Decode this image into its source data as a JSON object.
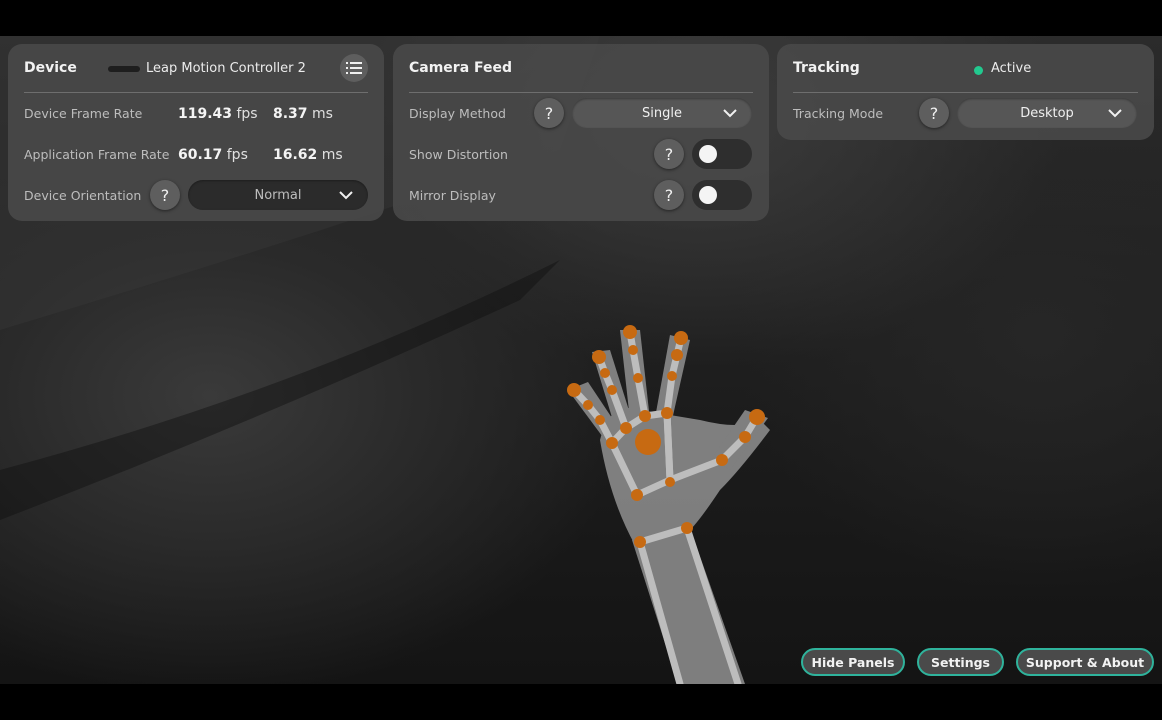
{
  "device": {
    "title": "Device",
    "device_name": "Leap Motion Controller 2",
    "menu_icon": "list-icon",
    "device_frame_rate": {
      "label": "Device Frame Rate",
      "fps": "119.43",
      "fps_unit": "fps",
      "ms": "8.37",
      "ms_unit": "ms"
    },
    "app_frame_rate": {
      "label": "Application Frame Rate",
      "fps": "60.17",
      "fps_unit": "fps",
      "ms": "16.62",
      "ms_unit": "ms"
    },
    "orientation": {
      "label": "Device Orientation",
      "help": "?",
      "value": "Normal"
    }
  },
  "camera_feed": {
    "title": "Camera Feed",
    "display_method": {
      "label": "Display Method",
      "help": "?",
      "value": "Single"
    },
    "show_distortion": {
      "label": "Show Distortion",
      "help": "?",
      "enabled": false
    },
    "mirror_display": {
      "label": "Mirror Display",
      "help": "?",
      "enabled": false
    }
  },
  "tracking": {
    "title": "Tracking",
    "status": "Active",
    "status_color": "#22c98f",
    "mode": {
      "label": "Tracking Mode",
      "help": "?",
      "value": "Desktop"
    }
  },
  "bottom_bar": {
    "hide_panels": "Hide Panels",
    "settings": "Settings",
    "support": "Support & About",
    "accent": "#2fb39c"
  },
  "hand_overlay": {
    "joint_color": "#c76a12",
    "bone_color": "#b9b9b9"
  }
}
